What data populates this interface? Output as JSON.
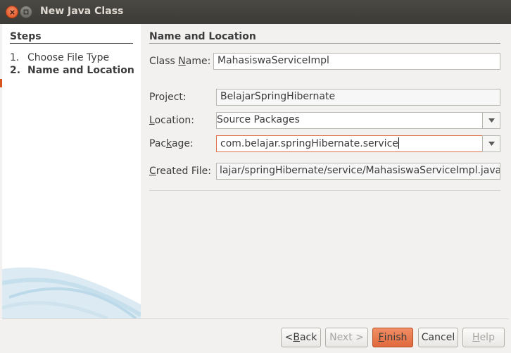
{
  "window": {
    "title": "New Java Class"
  },
  "steps": {
    "heading": "Steps",
    "items": [
      {
        "number": "1.",
        "label": "Choose File Type",
        "current": false
      },
      {
        "number": "2.",
        "label": "Name and Location",
        "current": true
      }
    ]
  },
  "panel": {
    "heading": "Name and Location",
    "class_name": {
      "label_before": "Class ",
      "label_mnemonic": "N",
      "label_after": "ame:",
      "value": "MahasiswaServiceImpl"
    },
    "project": {
      "label_before": "",
      "label_mnemonic": "",
      "label_after": "Project:",
      "value": "BelajarSpringHibernate"
    },
    "location": {
      "label_before": "",
      "label_mnemonic": "L",
      "label_after": "ocation:",
      "value": "Source Packages"
    },
    "package": {
      "label_before": "Pac",
      "label_mnemonic": "k",
      "label_after": "age:",
      "value": "com.belajar.springHibernate.service"
    },
    "created_file": {
      "label_before": "",
      "label_mnemonic": "C",
      "label_after": "reated File:",
      "value": "lajar/springHibernate/service/MahasiswaServiceImpl.java"
    }
  },
  "buttons": {
    "back": {
      "before": "< ",
      "mnemonic": "B",
      "after": "ack"
    },
    "next": {
      "label": "Next >"
    },
    "finish": {
      "before": "",
      "mnemonic": "F",
      "after": "inish"
    },
    "cancel": {
      "label": "Cancel"
    },
    "help": {
      "before": "",
      "mnemonic": "H",
      "after": "elp"
    }
  },
  "colors": {
    "accent": "#e0683c",
    "titlebar": "#3c3b37",
    "steps_bg": "#ffffff",
    "dialog_bg": "#f2f1f0"
  },
  "icons": {
    "close": "close-icon",
    "maximize": "maximize-icon",
    "dropdown": "chevron-down-icon"
  }
}
